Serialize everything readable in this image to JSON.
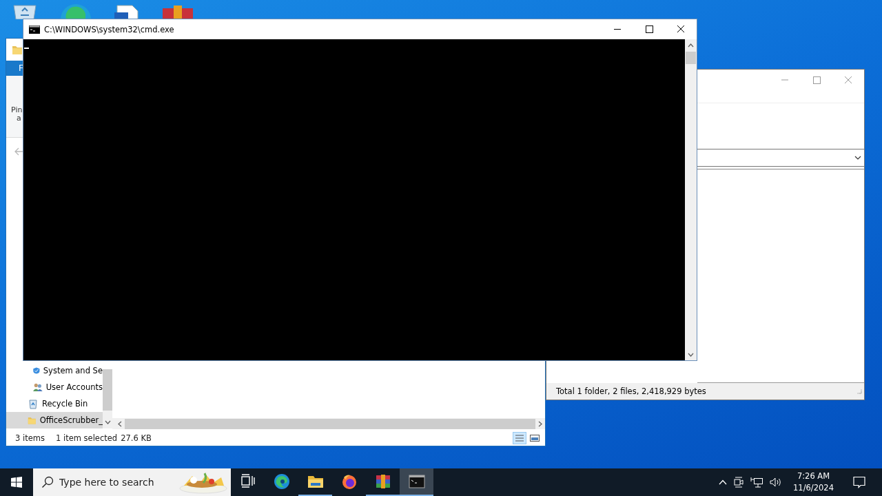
{
  "explorer_window": {
    "ribbon_tab": "F",
    "ribbon_label_lines": [
      "Pin",
      "a"
    ],
    "nav_items": [
      {
        "kind": "control-panel",
        "label": "System and Se",
        "selected": false
      },
      {
        "kind": "users",
        "label": "User Accounts",
        "selected": false
      },
      {
        "kind": "recycle-bin",
        "label": "Recycle Bin",
        "selected": false
      },
      {
        "kind": "folder",
        "label": "OfficeScrubber_",
        "selected": true
      }
    ],
    "status_bar": {
      "item_count": "3 items",
      "selection": "1 item selected",
      "size": "27.6 KB"
    }
  },
  "archive_window": {
    "status_bar": "Total 1 folder, 2 files, 2,418,929 bytes"
  },
  "console_window": {
    "title": "C:\\WINDOWS\\system32\\cmd.exe"
  },
  "taskbar": {
    "search": {
      "placeholder": "Type here to search"
    },
    "apps": [
      {
        "kind": "task-view",
        "running": false,
        "selected": false
      },
      {
        "kind": "edge",
        "running": false,
        "selected": false
      },
      {
        "kind": "explorer",
        "running": true,
        "selected": false
      },
      {
        "kind": "firefox",
        "running": false,
        "selected": false
      },
      {
        "kind": "winrar",
        "running": true,
        "selected": false
      },
      {
        "kind": "console",
        "running": true,
        "selected": true
      }
    ],
    "clock": {
      "time": "7:26 AM",
      "date": "11/6/2024"
    }
  }
}
